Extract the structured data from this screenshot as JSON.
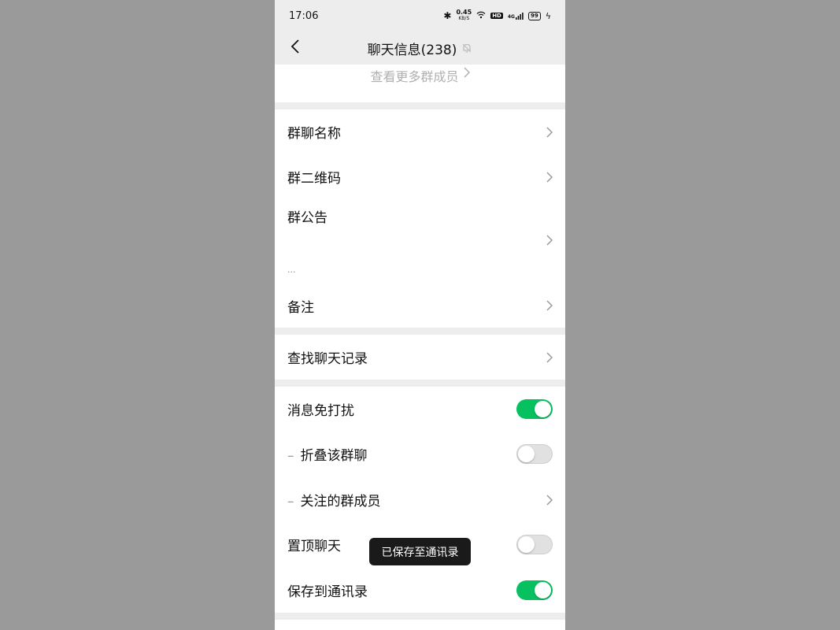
{
  "status_bar": {
    "time": "17:06",
    "net_speed": "0.45",
    "net_unit": "KB/S",
    "hd": "HD",
    "signal": "4G",
    "battery": "99"
  },
  "nav": {
    "title": "聊天信息(238)"
  },
  "members": {
    "more_label": "查看更多群成员"
  },
  "group_section": {
    "name_label": "群聊名称",
    "qrcode_label": "群二维码",
    "notice_label": "群公告",
    "notice_text": "...",
    "remark_label": "备注"
  },
  "search_section": {
    "search_label": "查找聊天记录"
  },
  "settings": {
    "mute_label": "消息免打扰",
    "mute_on": true,
    "fold_label": "折叠该群聊",
    "fold_on": false,
    "follow_label": "关注的群成员",
    "pin_label": "置顶聊天",
    "pin_on": false,
    "save_label": "保存到通讯录",
    "save_on": true
  },
  "toast": {
    "text": "已保存至通讯录"
  },
  "colors": {
    "accent": "#07c160",
    "background": "#ededed",
    "outer": "#9a9a9a"
  }
}
